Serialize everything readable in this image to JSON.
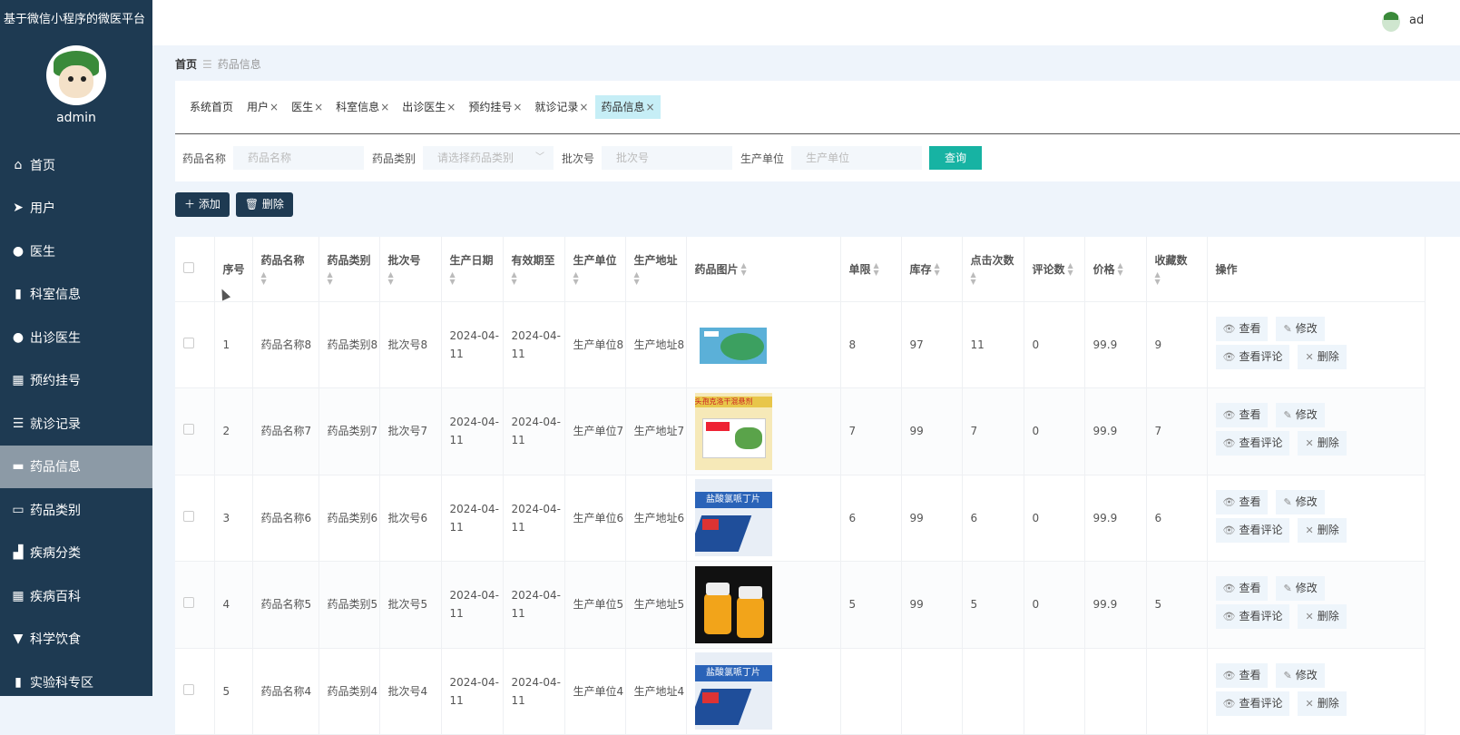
{
  "app": {
    "title": "基于微信小程序的微医平台",
    "user": "admin",
    "top_user": "ad"
  },
  "menu": [
    {
      "label": "首页",
      "icon": "home-icon",
      "glyph": "⌂"
    },
    {
      "label": "用户",
      "icon": "paper-plane-icon",
      "glyph": "➤"
    },
    {
      "label": "医生",
      "icon": "person-icon",
      "glyph": "●"
    },
    {
      "label": "科室信息",
      "icon": "book-icon",
      "glyph": "▮"
    },
    {
      "label": "出诊医生",
      "icon": "bulb-icon",
      "glyph": "●"
    },
    {
      "label": "预约挂号",
      "icon": "grid-icon",
      "glyph": "▦"
    },
    {
      "label": "就诊记录",
      "icon": "list-icon",
      "glyph": "☰"
    },
    {
      "label": "药品信息",
      "icon": "ticket-icon",
      "glyph": "▬"
    },
    {
      "label": "药品类别",
      "icon": "briefcase-icon",
      "glyph": "▭"
    },
    {
      "label": "疾病分类",
      "icon": "bar-chart-icon",
      "glyph": "▟"
    },
    {
      "label": "疾病百科",
      "icon": "grid-icon",
      "glyph": "▦"
    },
    {
      "label": "科学饮食",
      "icon": "monitor-icon",
      "glyph": "▼"
    },
    {
      "label": "实验科专区",
      "icon": "book-icon",
      "glyph": "▮"
    }
  ],
  "active_menu": 7,
  "breadcrumb": {
    "home": "首页",
    "sep": "☰",
    "current": "药品信息"
  },
  "tabs": [
    {
      "label": "系统首页",
      "closable": ""
    },
    {
      "label": "用户",
      "closable": "×"
    },
    {
      "label": "医生",
      "closable": "×"
    },
    {
      "label": "科室信息",
      "closable": "×"
    },
    {
      "label": "出诊医生",
      "closable": "×"
    },
    {
      "label": "预约挂号",
      "closable": "×"
    },
    {
      "label": "就诊记录",
      "closable": "×"
    },
    {
      "label": "药品信息",
      "closable": "×"
    }
  ],
  "active_tab": 7,
  "search": {
    "name_label": "药品名称",
    "name_placeholder": "药品名称",
    "type_label": "药品类别",
    "type_placeholder": "请选择药品类别",
    "batch_label": "批次号",
    "batch_placeholder": "批次号",
    "unit_label": "生产单位",
    "unit_placeholder": "生产单位",
    "query_button": "查询"
  },
  "actions": {
    "add": "添加",
    "delete": "删除"
  },
  "columns": [
    "序号",
    "药品名称",
    "药品类别",
    "批次号",
    "生产日期",
    "有效期至",
    "生产单位",
    "生产地址",
    "药品图片",
    "单限",
    "库存",
    "点击次数",
    "评论数",
    "价格",
    "收藏数",
    "操作"
  ],
  "row_buttons": {
    "view": "查看",
    "edit": "修改",
    "comments": "查看评论",
    "delete": "删除"
  },
  "rows": [
    {
      "idx": "1",
      "name": "药品名称8",
      "type": "药品类别8",
      "batch": "批次号8",
      "pdate": "2024-04-11",
      "edate": "2024-04-11",
      "unit": "生产单位8",
      "addr": "生产地址8",
      "image": "medicine-box-green",
      "limit": "8",
      "stock": "97",
      "clicks": "11",
      "comments": "0",
      "price": "99.9",
      "fav": "9"
    },
    {
      "idx": "2",
      "name": "药品名称7",
      "type": "药品类别7",
      "batch": "批次号7",
      "pdate": "2024-04-11",
      "edate": "2024-04-11",
      "unit": "生产单位7",
      "addr": "生产地址7",
      "image": "medicine-box-yellow",
      "limit": "7",
      "stock": "99",
      "clicks": "7",
      "comments": "0",
      "price": "99.9",
      "fav": "7"
    },
    {
      "idx": "3",
      "name": "药品名称6",
      "type": "药品类别6",
      "batch": "批次号6",
      "pdate": "2024-04-11",
      "edate": "2024-04-11",
      "unit": "生产单位6",
      "addr": "生产地址6",
      "image": "medicine-box-blue",
      "limit": "6",
      "stock": "99",
      "clicks": "6",
      "comments": "0",
      "price": "99.9",
      "fav": "6"
    },
    {
      "idx": "4",
      "name": "药品名称5",
      "type": "药品类别5",
      "batch": "批次号5",
      "pdate": "2024-04-11",
      "edate": "2024-04-11",
      "unit": "生产单位5",
      "addr": "生产地址5",
      "image": "medicine-bottles",
      "limit": "5",
      "stock": "99",
      "clicks": "5",
      "comments": "0",
      "price": "99.9",
      "fav": "5"
    },
    {
      "idx": "5",
      "name": "药品名称4",
      "type": "药品类别4",
      "batch": "批次号4",
      "pdate": "2024-04-11",
      "edate": "2024-04-11",
      "unit": "生产单位4",
      "addr": "生产地址4",
      "image": "medicine-box-blue",
      "limit": "",
      "stock": "",
      "clicks": "",
      "comments": "",
      "price": "",
      "fav": ""
    }
  ],
  "image_text": {
    "blue_box": "盐酸氯哌丁片",
    "yellow_box": "头孢克洛干混悬剂"
  },
  "colors": {
    "sidebar": "#1e3a52",
    "active_menu": "#8c9aa6",
    "query": "#17b3a3",
    "active_tab": "#c6eef6"
  }
}
